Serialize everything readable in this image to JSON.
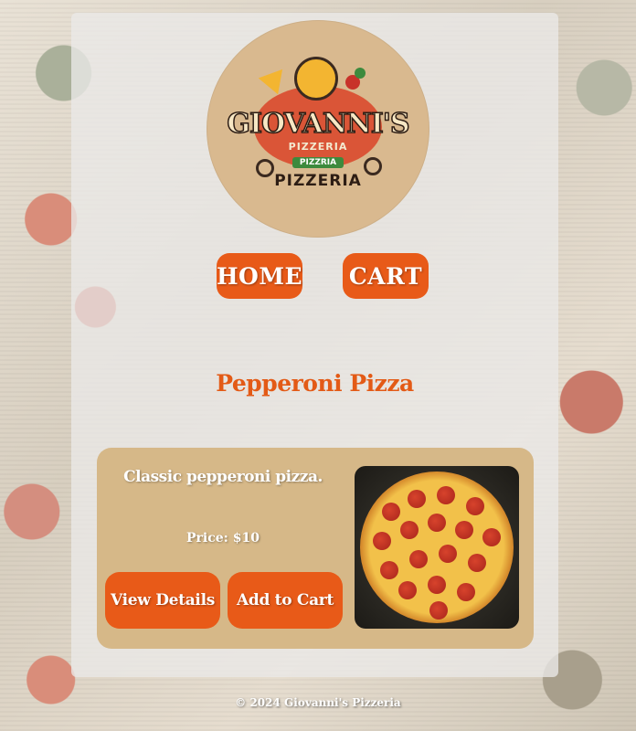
{
  "logo": {
    "brand": "GIOVANNI'S",
    "line1": "PIZZERIA",
    "line2": "PIZZRIA",
    "line3": "PIZZERIA"
  },
  "nav": {
    "home_label": "HOME",
    "cart_label": "CART"
  },
  "product": {
    "title": "Pepperoni Pizza",
    "description": "Classic pepperoni pizza.",
    "price": "Price: $10",
    "view_details_label": "View Details",
    "add_to_cart_label": "Add to Cart"
  },
  "footer": {
    "text": "© 2024 Giovanni's Pizzeria"
  },
  "colors": {
    "accent": "#e85a18",
    "title": "#e35a16",
    "card": "#d6b888"
  }
}
